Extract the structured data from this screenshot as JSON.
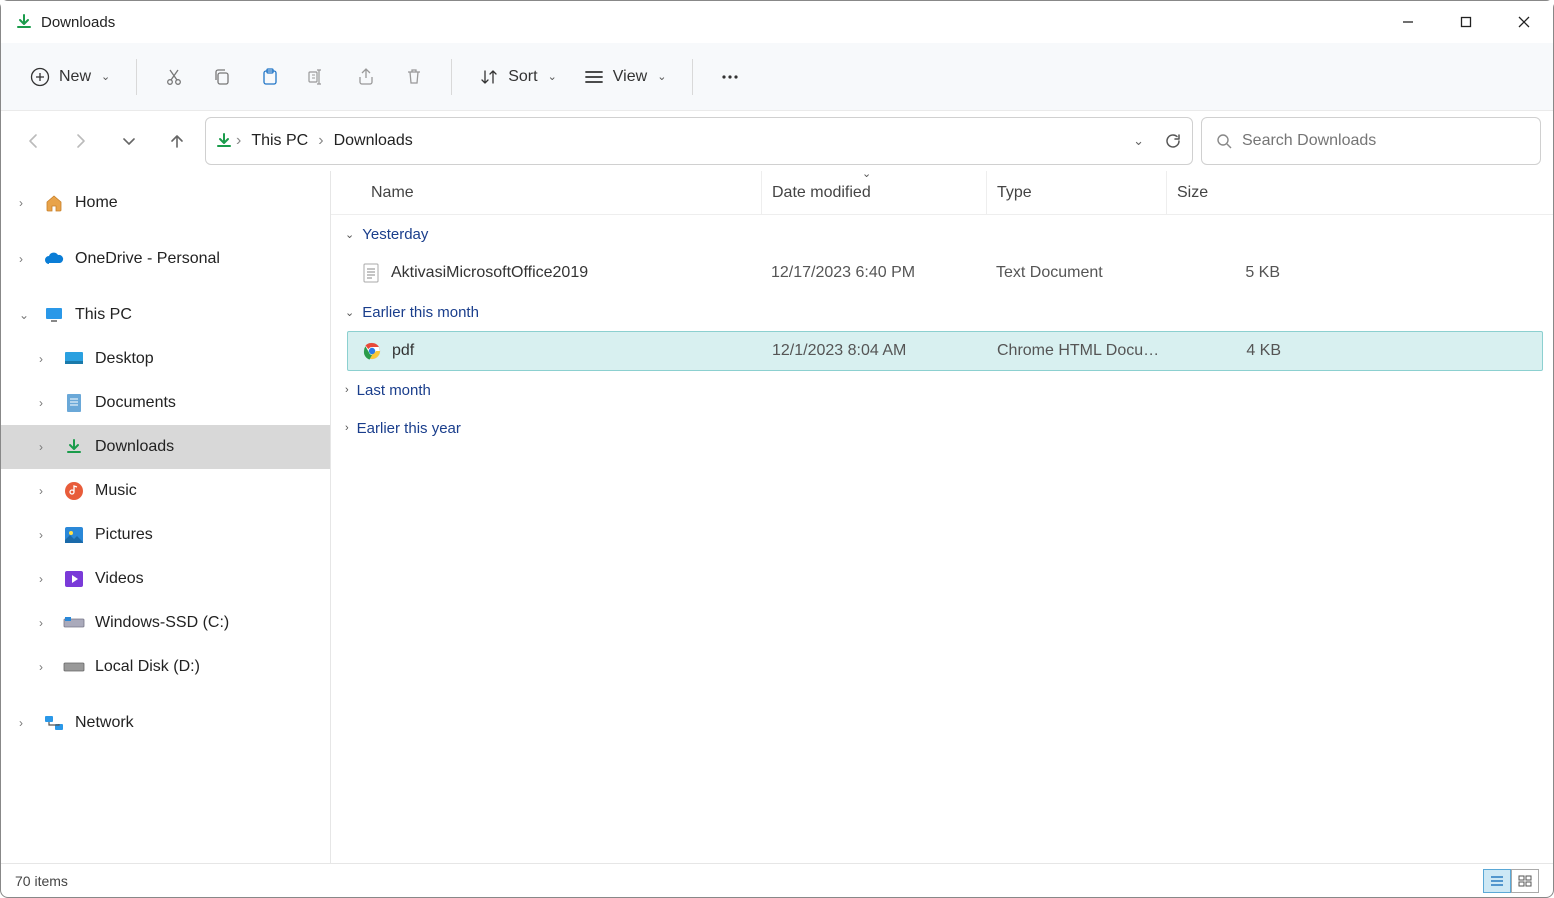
{
  "window": {
    "title": "Downloads"
  },
  "toolbar": {
    "new": "New",
    "sort": "Sort",
    "view": "View"
  },
  "breadcrumb": {
    "root": "This PC",
    "current": "Downloads"
  },
  "search": {
    "placeholder": "Search Downloads"
  },
  "sidebar": {
    "home": "Home",
    "onedrive": "OneDrive - Personal",
    "thispc": "This PC",
    "desktop": "Desktop",
    "documents": "Documents",
    "downloads": "Downloads",
    "music": "Music",
    "pictures": "Pictures",
    "videos": "Videos",
    "drive_c": "Windows-SSD (C:)",
    "drive_d": "Local Disk (D:)",
    "network": "Network"
  },
  "columns": {
    "name": "Name",
    "date": "Date modified",
    "type": "Type",
    "size": "Size"
  },
  "groups": {
    "yesterday": "Yesterday",
    "earlier_month": "Earlier this month",
    "last_month": "Last month",
    "earlier_year": "Earlier this year"
  },
  "files": {
    "f1": {
      "name": "AktivasiMicrosoftOffice2019",
      "date": "12/17/2023 6:40 PM",
      "type": "Text Document",
      "size": "5 KB"
    },
    "f2": {
      "name": "pdf",
      "date": "12/1/2023 8:04 AM",
      "type": "Chrome HTML Docu…",
      "size": "4 KB"
    }
  },
  "status": {
    "count": "70 items"
  }
}
